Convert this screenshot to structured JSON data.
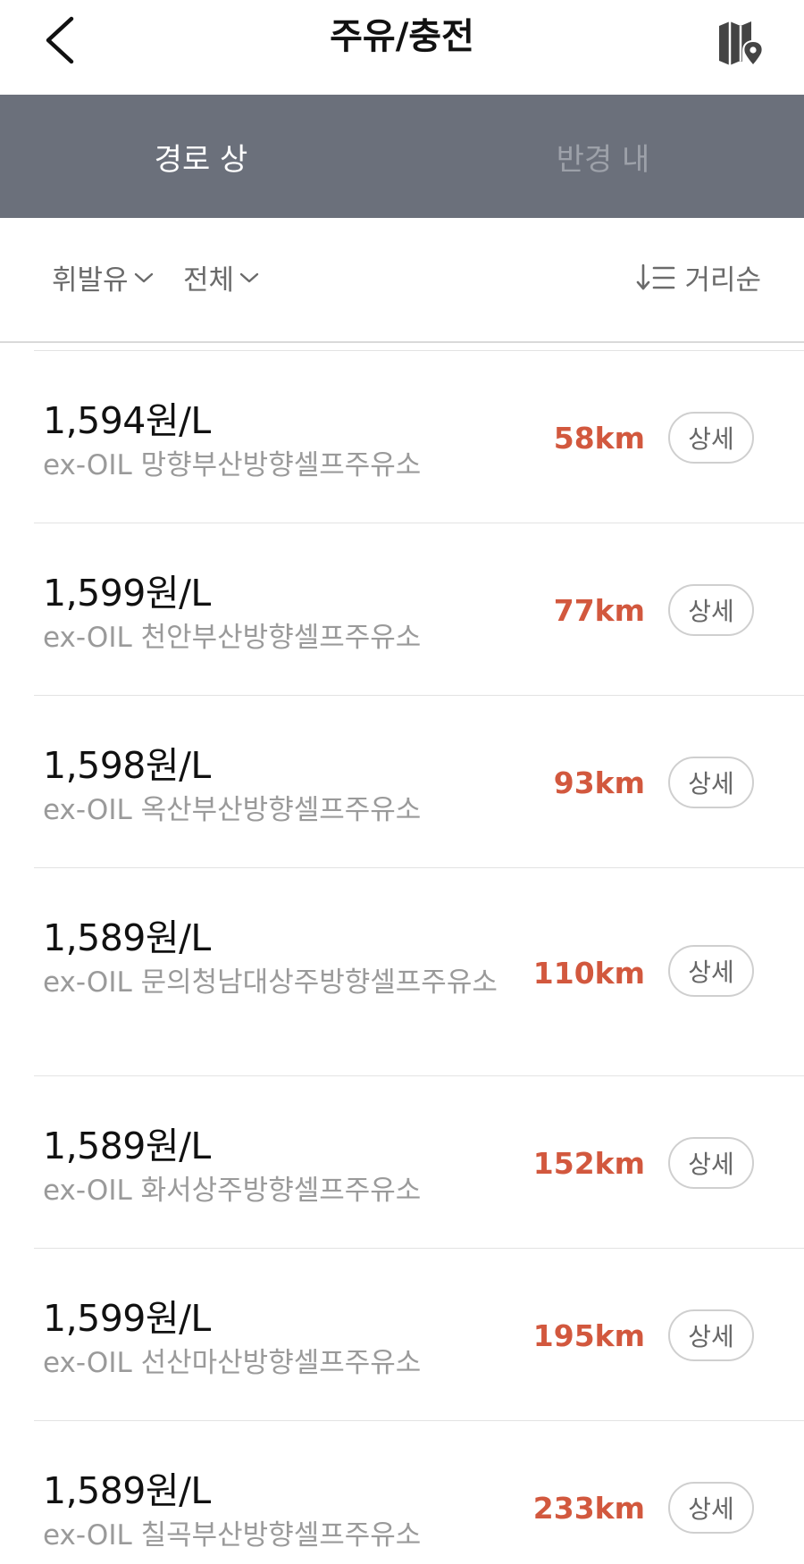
{
  "header": {
    "title": "주유/충전"
  },
  "tabs": [
    {
      "label": "경로 상",
      "active": true
    },
    {
      "label": "반경 내",
      "active": false
    }
  ],
  "filters": {
    "fuel": "휘발유",
    "brand": "전체",
    "sort": "거리순"
  },
  "stations": [
    {
      "price": "1,594원/L",
      "name": "ex-OIL 망향부산방향셀프주유소",
      "distance": "58km",
      "detail": "상세"
    },
    {
      "price": "1,599원/L",
      "name": "ex-OIL 천안부산방향셀프주유소",
      "distance": "77km",
      "detail": "상세"
    },
    {
      "price": "1,598원/L",
      "name": "ex-OIL 옥산부산방향셀프주유소",
      "distance": "93km",
      "detail": "상세"
    },
    {
      "price": "1,589원/L",
      "name": "ex-OIL 문의청남대상주방향셀프주유소",
      "distance": "110km",
      "detail": "상세"
    },
    {
      "price": "1,589원/L",
      "name": "ex-OIL 화서상주방향셀프주유소",
      "distance": "152km",
      "detail": "상세"
    },
    {
      "price": "1,599원/L",
      "name": "ex-OIL 선산마산방향셀프주유소",
      "distance": "195km",
      "detail": "상세"
    },
    {
      "price": "1,589원/L",
      "name": "ex-OIL 칠곡부산방향셀프주유소",
      "distance": "233km",
      "detail": "상세"
    }
  ],
  "colors": {
    "tab_bar": "#6b707b",
    "distance": "#d2583e",
    "secondary_text": "#9a9a9a"
  }
}
